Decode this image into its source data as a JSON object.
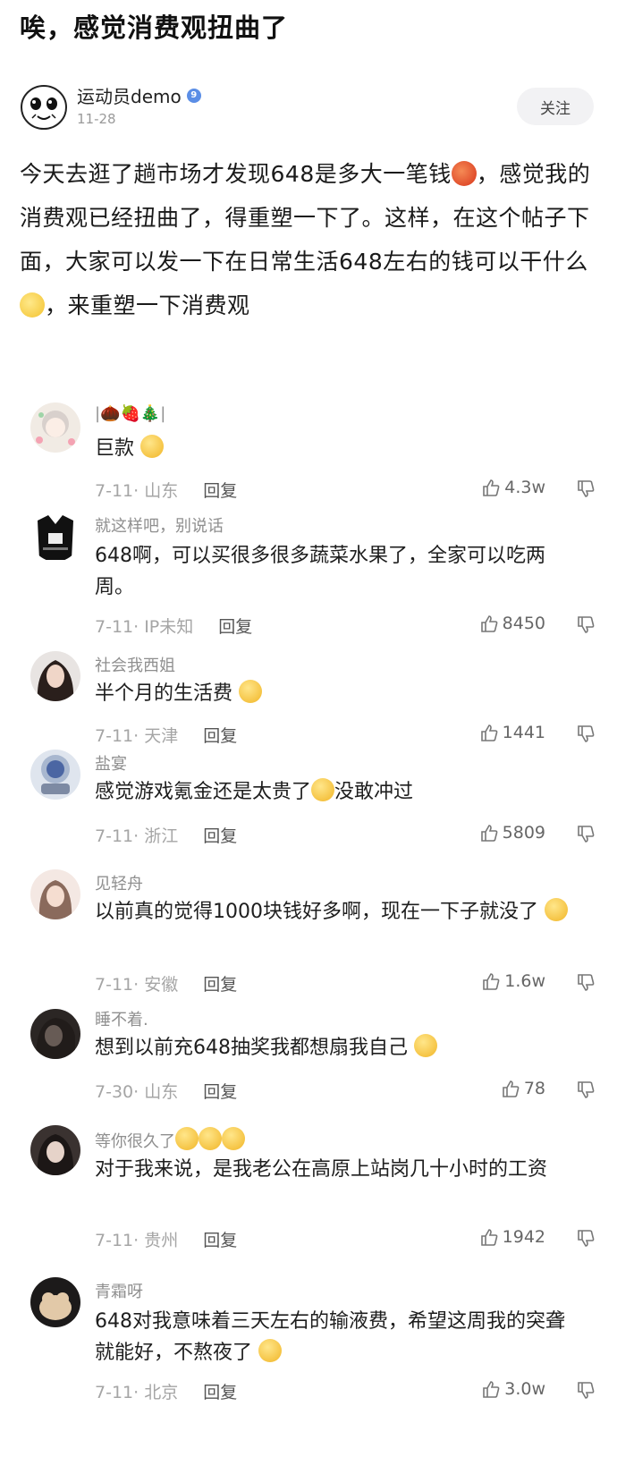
{
  "post": {
    "title": "唉，感觉消费观扭曲了",
    "author": "运动员demo",
    "verified_badge": "9",
    "date": "11-28",
    "follow_label": "关注",
    "body_part1": "今天去逛了趟市场才发现648是多大一笔钱",
    "body_part2": "，感觉我的消费观已经扭曲了，得重塑一下了。这样，在这个帖子下面，大家可以发一下在日常生活648左右的钱可以干什么",
    "body_part3": "，来重塑一下消费观"
  },
  "reply_label": "回复",
  "comments": [
    {
      "user": "|🌰🍓🎄|",
      "text": "巨款",
      "meta": "7-11· 山东",
      "likes": "4.3w"
    },
    {
      "user": "就这样吧，别说话",
      "text": "648啊，可以买很多很多蔬菜水果了，全家可以吃两周。",
      "meta": "7-11· IP未知",
      "likes": "8450"
    },
    {
      "user": "社会我西姐",
      "text": "半个月的生活费",
      "meta": "7-11· 天津",
      "likes": "1441"
    },
    {
      "user": "盐宴",
      "text": "感觉游戏氪金还是太贵了",
      "text2": "没敢冲过",
      "meta": "7-11· 浙江",
      "likes": "5809"
    },
    {
      "user": "见轻舟",
      "text": "以前真的觉得1000块钱好多啊，现在一下子就没了",
      "meta": "7-11· 安徽",
      "likes": "1.6w"
    },
    {
      "user": "睡不着.",
      "text": "想到以前充648抽奖我都想扇我自己",
      "meta": "7-30· 山东",
      "likes": "78"
    },
    {
      "user": "等你很久了",
      "text": "对于我来说，是我老公在高原上站岗几十小时的工资",
      "meta": "7-11· 贵州",
      "likes": "1942"
    },
    {
      "user": "青霜呀",
      "text": "648对我意味着三天左右的输液费，希望这周我的突聋就能好，不熬夜了",
      "meta": "7-11· 北京",
      "likes": "3.0w"
    }
  ]
}
